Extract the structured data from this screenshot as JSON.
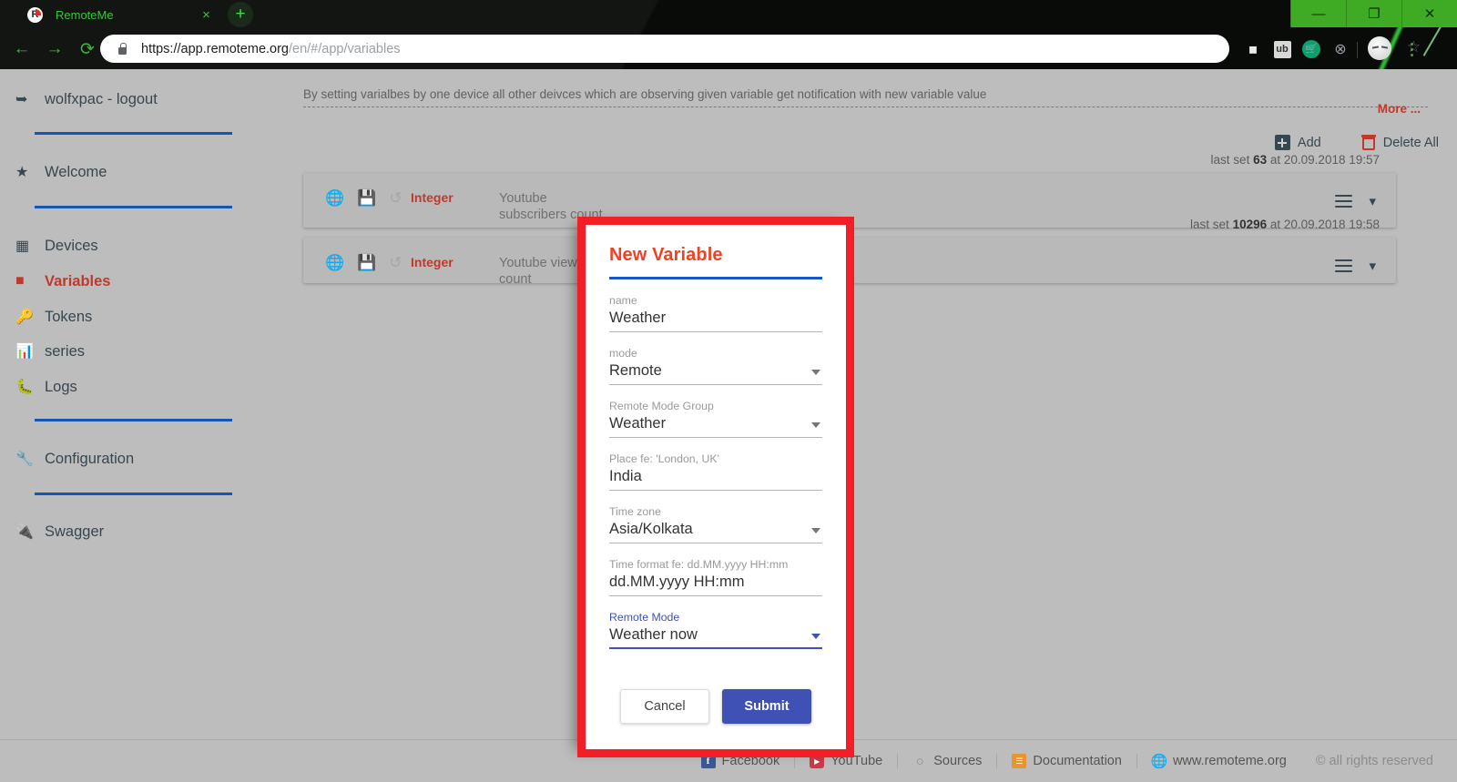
{
  "browser": {
    "tab": {
      "title": "RemoteMe",
      "favicon": "remoteme-logo-icon",
      "close_label": "×"
    },
    "new_tab_label": "+",
    "window_controls": {
      "minimize": "—",
      "maximize": "❐",
      "close": "✕"
    },
    "nav": {
      "back": "←",
      "forward": "→",
      "reload": "⟳"
    },
    "omnibox": {
      "url_host": "https://app.remoteme.org",
      "url_path": "/en/#/app/variables",
      "key_icon": "⚷",
      "star_icon": "☆"
    },
    "extensions": {
      "cube": "⬛",
      "ublock": "ub",
      "cart": "Ὥ2",
      "block": "⊗"
    },
    "menu_dots": 3
  },
  "sidebar": {
    "logout": {
      "label": "wolfxpac - logout",
      "icon": "logout-icon"
    },
    "items": [
      {
        "label": "Welcome",
        "icon": "star-icon",
        "active": false
      },
      {
        "label": "Devices",
        "icon": "chip-icon",
        "active": false
      },
      {
        "label": "Variables",
        "icon": "variable-file-icon",
        "active": true
      },
      {
        "label": "Tokens",
        "icon": "key-icon",
        "active": false
      },
      {
        "label": "series",
        "icon": "bar-chart-icon",
        "active": false
      },
      {
        "label": "Logs",
        "icon": "bug-icon",
        "active": false
      },
      {
        "label": "Configuration",
        "icon": "wrench-icon",
        "active": false
      },
      {
        "label": "Swagger",
        "icon": "plug-icon",
        "active": false
      }
    ],
    "separator_color": "#1557b0"
  },
  "content": {
    "info_text": "By setting varialbes by one device all other deivces which are observing given variable get notification with new variable value",
    "more_label": "More ...",
    "add_label": "Add",
    "delete_all_label": "Delete All",
    "rows": [
      {
        "type": "Integer",
        "name": "Youtube subscribers count",
        "meta_prefix": "last set",
        "meta_value": "63",
        "meta_suffix": "at 20.09.2018 19:57",
        "icons": [
          "globe-icon",
          "save-icon",
          "history-icon"
        ]
      },
      {
        "type": "Integer",
        "name": "Youtube view count",
        "meta_prefix": "last set",
        "meta_value": "10296",
        "meta_suffix": "at 20.09.2018 19:58",
        "icons": [
          "globe-icon",
          "save-icon",
          "history-icon"
        ]
      }
    ]
  },
  "modal": {
    "title": "New Variable",
    "accent_border": "#f31f27",
    "title_color": "#f04124",
    "rule_color": "#1a56c4",
    "fields": [
      {
        "label": "name",
        "value": "Weather",
        "kind": "text",
        "focused": false
      },
      {
        "label": "mode",
        "value": "Remote",
        "kind": "select",
        "focused": false
      },
      {
        "label": "Remote Mode Group",
        "value": "Weather",
        "kind": "select",
        "focused": false
      },
      {
        "label": "Place fe: 'London, UK'",
        "value": "India",
        "kind": "text",
        "focused": false
      },
      {
        "label": "Time zone",
        "value": "Asia/Kolkata",
        "kind": "select",
        "focused": false
      },
      {
        "label": "Time format fe: dd.MM.yyyy HH:mm",
        "value": "dd.MM.yyyy HH:mm",
        "kind": "text",
        "focused": false
      },
      {
        "label": "Remote Mode",
        "value": "Weather now",
        "kind": "select",
        "focused": true
      }
    ],
    "cancel_label": "Cancel",
    "submit_label": "Submit"
  },
  "footer": {
    "items": [
      {
        "label": "Facebook",
        "icon": "facebook-icon",
        "glyph": "f"
      },
      {
        "label": "YouTube",
        "icon": "youtube-icon",
        "glyph": "▶"
      },
      {
        "label": "Sources",
        "icon": "github-icon",
        "glyph": "○"
      },
      {
        "label": "Documentation",
        "icon": "book-icon",
        "glyph": "☰"
      },
      {
        "label": "www.remoteme.org",
        "icon": "globe-icon",
        "glyph": "⊕"
      }
    ],
    "rights": "© all rights reserved"
  }
}
